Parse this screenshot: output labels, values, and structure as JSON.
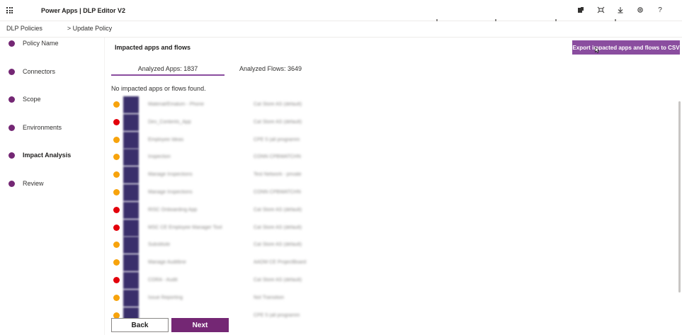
{
  "topbar": {
    "app_title": "Power Apps | DLP Editor V2",
    "icons": [
      "copilot-icon",
      "presence-icon",
      "download-icon",
      "gear-icon",
      "help-icon"
    ],
    "help_glyph": "?"
  },
  "breadcrumb": {
    "root": "DLP Policies",
    "current": "> Update Policy"
  },
  "steps": [
    {
      "label": "Policy Name"
    },
    {
      "label": "Connectors"
    },
    {
      "label": "Scope"
    },
    {
      "label": "Environments"
    },
    {
      "label": "Impact Analysis",
      "active": true
    },
    {
      "label": "Review"
    }
  ],
  "main": {
    "section_title": "Impacted apps and flows",
    "export_label": "Export impacted apps and flows to CSV",
    "tabs": [
      {
        "label": "Analyzed Apps: 1837",
        "selected": true
      },
      {
        "label": "Analyzed Flows: 3649",
        "selected": false
      }
    ],
    "empty_message": "No impacted apps or flows found.",
    "rows": [
      {
        "status": "warning",
        "name": "Material/Emalum - Phone",
        "env": "Cat Store AS (default)"
      },
      {
        "status": "error",
        "name": "Dev_Contents_App",
        "env": "Cat Store AS (default)"
      },
      {
        "status": "warning",
        "name": "Employee Ideas",
        "env": "CPE 5 (all programm"
      },
      {
        "status": "warning",
        "name": "Inspection",
        "env": "CONN CPBWATCHN"
      },
      {
        "status": "warning",
        "name": "Manage Inspections",
        "env": "Test Network - private"
      },
      {
        "status": "warning",
        "name": "Manage Inspections",
        "env": "CONN CPBWATCHN"
      },
      {
        "status": "error",
        "name": "RISC Onboarding App",
        "env": "Cat Store AS (default)"
      },
      {
        "status": "error",
        "name": "MSC CE Employee Manager Tool",
        "env": "Cat Store AS (default)"
      },
      {
        "status": "warning",
        "name": "Substitute",
        "env": "Cat Store AS (default)"
      },
      {
        "status": "warning",
        "name": "Manage Auditline",
        "env": "AADM CE ProjectBoard"
      },
      {
        "status": "error",
        "name": "CORA - Audit",
        "env": "Cat Store AS (default)"
      },
      {
        "status": "warning",
        "name": "Issue Reporting",
        "env": "Not Transition"
      },
      {
        "status": "warning",
        "name": "",
        "env": "CPE 5 (all programm"
      }
    ]
  },
  "footer": {
    "back_label": "Back",
    "next_label": "Next"
  },
  "colors": {
    "accent": "#742774",
    "export_button": "#8a4d9f",
    "status_warning": "#f7a30c",
    "status_error": "#e3000b"
  }
}
